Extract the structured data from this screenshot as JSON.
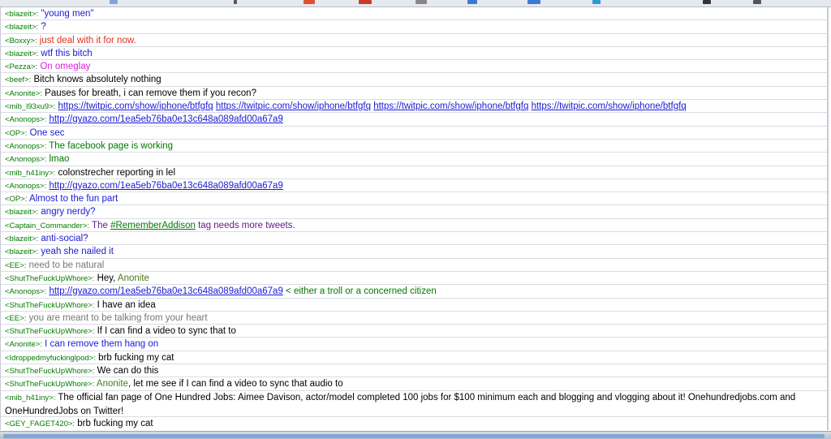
{
  "colors": {
    "nick": "#007a00",
    "blue": "#1a1ad6",
    "red": "#e0301a",
    "magenta": "#e020e0",
    "black": "#000000",
    "green": "#007a00",
    "gray": "#777777",
    "purple": "#6a1a8a",
    "olive": "#4a7a1a"
  },
  "messages": [
    {
      "nick": "<blazeit>:",
      "text": "\"young men\"",
      "color": "blue"
    },
    {
      "nick": "<blazeit>:",
      "text": "?",
      "color": "blue"
    },
    {
      "nick": "<Boxxy>:",
      "text": "just deal with it for now.",
      "color": "red"
    },
    {
      "nick": "<blazeit>:",
      "text": "wtf this bitch",
      "color": "blue"
    },
    {
      "nick": "<Pezza>:",
      "text": "On omeglay",
      "color": "magenta"
    },
    {
      "nick": "<beef>:",
      "text": "Bitch knows absolutely nothing",
      "color": "black"
    },
    {
      "nick": "<Anonite>:",
      "text": "Pauses for breath, i can remove them if you recon?",
      "color": "black"
    },
    {
      "nick": "<mib_l93xu9>:",
      "links": [
        "https://twitpic.com/show/iphone/btfgfq",
        "https://twitpic.com/show/iphone/btfgfq",
        "https://twitpic.com/show/iphone/btfgfq",
        "https://twitpic.com/show/iphone/btfgfq"
      ]
    },
    {
      "nick": "<Anonops>:",
      "links": [
        "http://gyazo.com/1ea5eb76ba0e13c648a089afd00a67a9"
      ]
    },
    {
      "nick": "<OP>:",
      "text": "One sec",
      "color": "blue"
    },
    {
      "nick": "<Anonops>:",
      "text": "The facebook page is working",
      "color": "green"
    },
    {
      "nick": "<Anonops>:",
      "text": "lmao",
      "color": "green"
    },
    {
      "nick": "<mib_h41iny>:",
      "text": "colonstrecher reporting in lel",
      "color": "black"
    },
    {
      "nick": "<Anonops>:",
      "links": [
        "http://gyazo.com/1ea5eb76ba0e13c648a089afd00a67a9"
      ]
    },
    {
      "nick": "<OP>:",
      "text": "Almost to the fun part",
      "color": "blue"
    },
    {
      "nick": "<blazeit>:",
      "text": "angry nerdy?",
      "color": "blue"
    },
    {
      "nick": "<Captain_Commander>:",
      "pre": "The ",
      "tag": "#RememberAddison",
      "post": " tag needs more tweets.",
      "color": "purple"
    },
    {
      "nick": "<blazeit>:",
      "text": "anti-social?",
      "color": "blue"
    },
    {
      "nick": "<blazeit>:",
      "text": "yeah she nailed it",
      "color": "blue"
    },
    {
      "nick": "<EE>:",
      "text": "need to be natural",
      "color": "gray"
    },
    {
      "nick": "<ShutTheFuckUpWhore>:",
      "pre": "Hey, ",
      "mention": "Anonite",
      "color": "black"
    },
    {
      "nick": "<Anonops>:",
      "links": [
        "http://gyazo.com/1ea5eb76ba0e13c648a089afd00a67a9"
      ],
      "post": " < either a troll or a concerned citizen",
      "color": "green"
    },
    {
      "nick": "<ShutTheFuckUpWhore>:",
      "text": "I have an idea",
      "color": "black"
    },
    {
      "nick": "<EE>:",
      "text": "you are meant to be talking from your heart",
      "color": "gray"
    },
    {
      "nick": "<ShutTheFuckUpWhore>:",
      "text": "If I can find a video to sync that to",
      "color": "black"
    },
    {
      "nick": "<Anonite>:",
      "text": "I can remove them hang on",
      "color": "blue"
    },
    {
      "nick": "<Idroppedmyfuckinglpod>:",
      "text": "brb fucking my cat",
      "color": "black"
    },
    {
      "nick": "<ShutTheFuckUpWhore>:",
      "text": "We can do this",
      "color": "black"
    },
    {
      "nick": "<ShutTheFuckUpWhore>:",
      "mention": "Anonite",
      "post": ", let me see if I can find a video to sync that audio to",
      "color": "black"
    },
    {
      "nick": "<mib_h41iny>:",
      "text": "The official fan page of One Hundred Jobs: Aimee Davison, actor/model completed 100 jobs for $100 minimum each and blogging and vlogging about it! Onehundredjobs.com and OneHundredJobs on Twitter!",
      "color": "black",
      "wrap": true
    },
    {
      "nick": "<GEY_FAGET420>:",
      "text": "brb fucking my cat",
      "color": "black"
    }
  ]
}
